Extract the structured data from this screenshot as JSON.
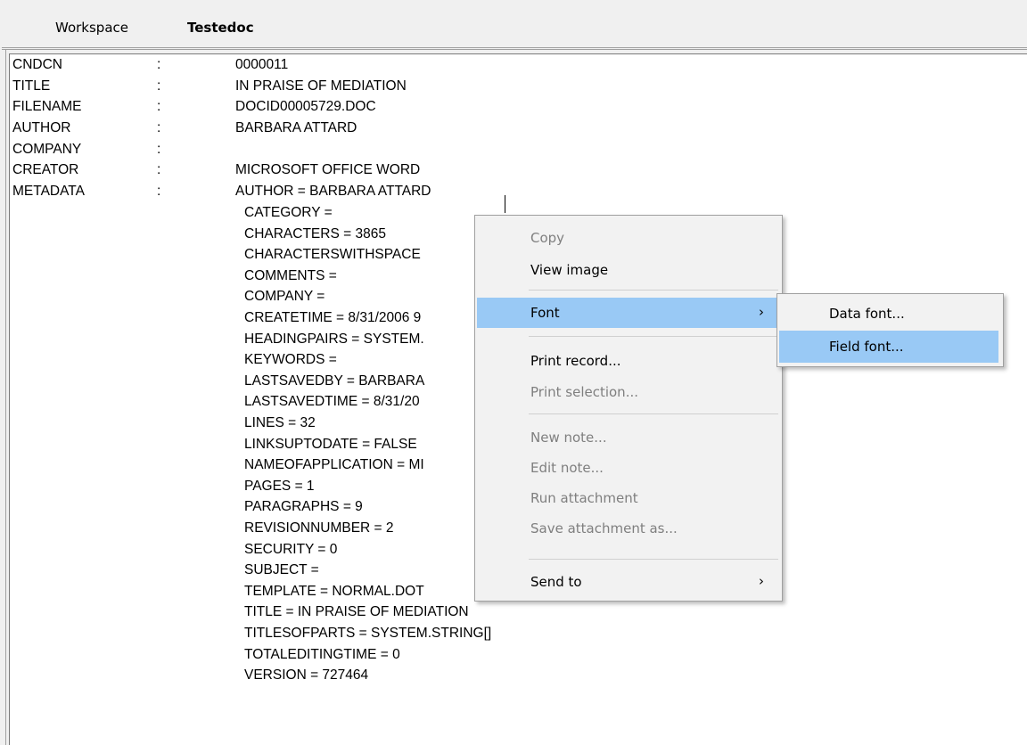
{
  "tabs": [
    {
      "label": "Workspace",
      "active": false
    },
    {
      "label": "Testedoc",
      "active": true
    }
  ],
  "record": [
    {
      "field": "CNDCN",
      "sep": ":",
      "value": "0000011"
    },
    {
      "field": "TITLE",
      "sep": ":",
      "value": "IN PRAISE OF MEDIATION"
    },
    {
      "field": "FILENAME",
      "sep": ":",
      "value": "DOCID00005729.DOC"
    },
    {
      "field": "AUTHOR",
      "sep": ":",
      "value": "BARBARA ATTARD"
    },
    {
      "field": "COMPANY",
      "sep": ":",
      "value": ""
    },
    {
      "field": "CREATOR",
      "sep": ":",
      "value": "MICROSOFT OFFICE WORD"
    },
    {
      "field": "METADATA",
      "sep": ":",
      "value": "AUTHOR = BARBARA ATTARD"
    }
  ],
  "metadata_lines": [
    "CATEGORY =",
    "CHARACTERS = 3865",
    "CHARACTERSWITHSPACE",
    "COMMENTS =",
    "COMPANY =",
    "CREATETIME = 8/31/2006 9",
    "HEADINGPAIRS = SYSTEM.",
    "KEYWORDS =",
    "LASTSAVEDBY = BARBARA",
    "LASTSAVEDTIME = 8/31/20",
    "LINES = 32",
    "LINKSUPTODATE = FALSE",
    "NAMEOFAPPLICATION = MI",
    "PAGES = 1",
    "PARAGRAPHS = 9",
    "REVISIONNUMBER = 2",
    "SECURITY = 0",
    "SUBJECT =",
    "TEMPLATE = NORMAL.DOT",
    "TITLE = IN PRAISE OF MEDIATION",
    "TITLESOFPARTS = SYSTEM.STRING[]",
    "TOTALEDITINGTIME = 0",
    "VERSION = 727464"
  ],
  "context_menu": {
    "copy": "Copy",
    "view_image": "View image",
    "font": "Font",
    "print_record": "Print record...",
    "print_selection": "Print selection...",
    "new_note": "New note...",
    "edit_note": "Edit note...",
    "run_attachment": "Run attachment",
    "save_attachment_as": "Save attachment as...",
    "send_to": "Send to",
    "arrow": "›"
  },
  "font_submenu": {
    "data_font": "Data font...",
    "field_font": "Field font..."
  },
  "colors": {
    "hover": "#99c9f5",
    "disabled": "#7f7f7f"
  }
}
